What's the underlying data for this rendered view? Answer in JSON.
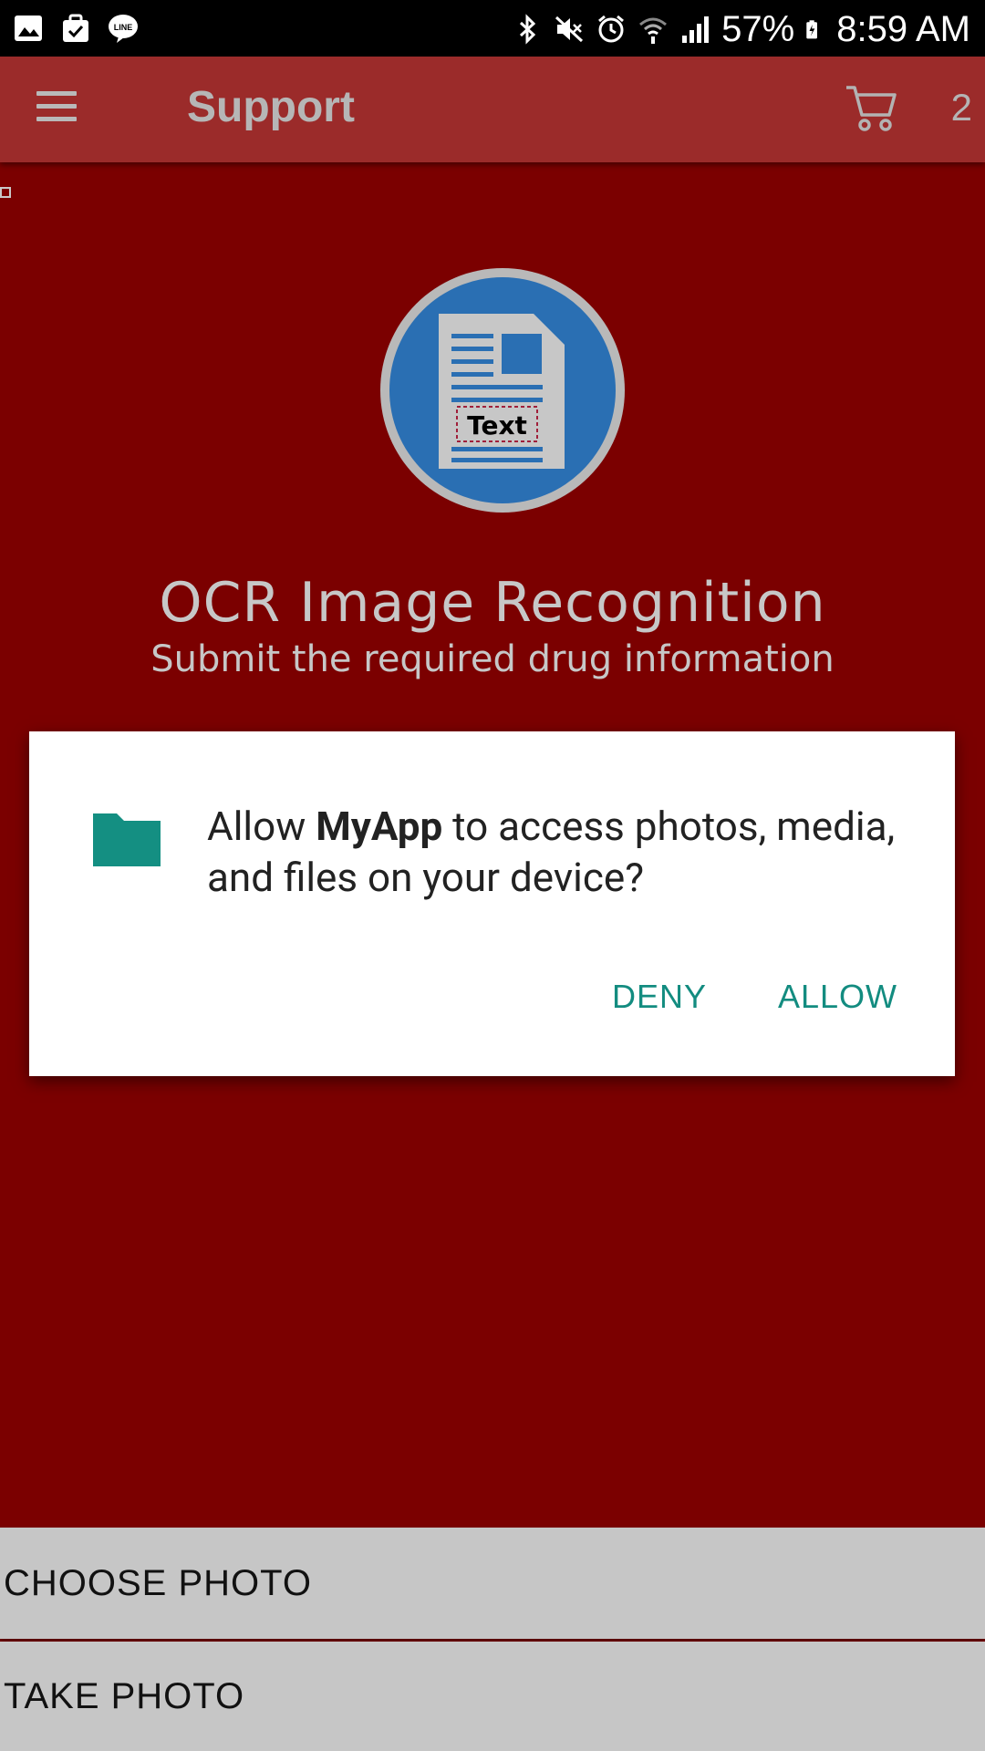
{
  "status_bar": {
    "battery": "57%",
    "time": "8:59 AM",
    "left_icons": [
      "gallery-icon",
      "bag-check-icon",
      "line-app-icon"
    ],
    "right_icons": [
      "bluetooth-icon",
      "mute-icon",
      "alarm-icon",
      "wifi-icon",
      "signal-icon",
      "battery-icon"
    ]
  },
  "app_bar": {
    "title": "Support",
    "cart_count": "2",
    "background": "#9b2b2a"
  },
  "hero": {
    "logo_text": "Text",
    "title": "OCR Image Recognition",
    "subtitle": "Submit the required drug information"
  },
  "dialog": {
    "message_prefix": "Allow ",
    "app_name": "MyApp",
    "message_suffix": " to access photos, media, and files on your device?",
    "deny_label": "DENY",
    "allow_label": "ALLOW",
    "accent": "#138c80"
  },
  "actions": {
    "choose_photo": "CHOOSE PHOTO",
    "take_photo": "TAKE PHOTO"
  }
}
